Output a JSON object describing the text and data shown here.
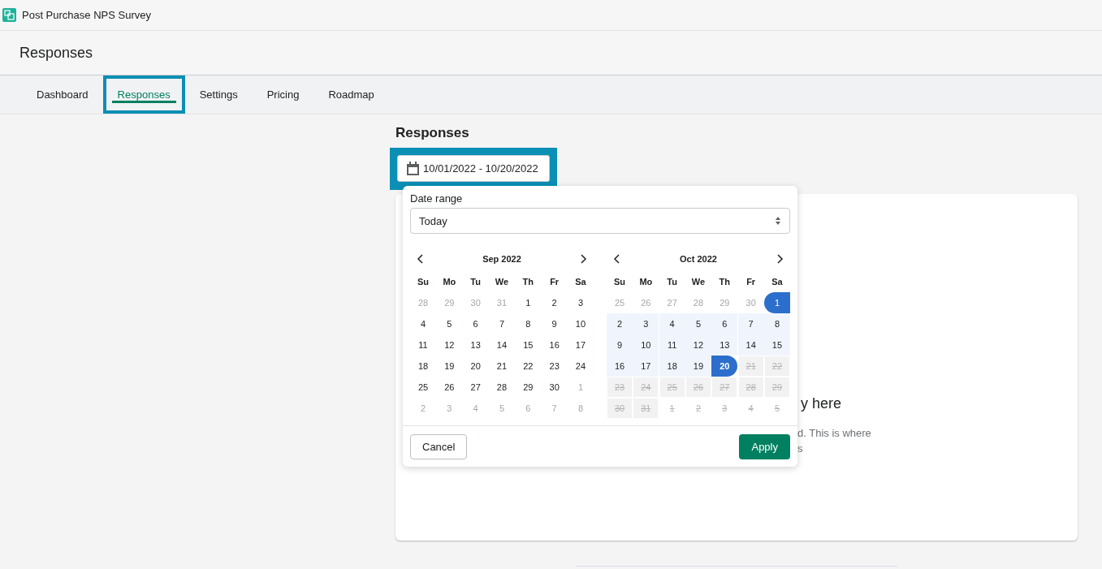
{
  "app_bar": {
    "title": "Post Purchase NPS Survey"
  },
  "page_header": {
    "title": "Responses"
  },
  "tabs": [
    {
      "label": "Dashboard",
      "selected": false,
      "highlighted": false
    },
    {
      "label": "Responses",
      "selected": true,
      "highlighted": true
    },
    {
      "label": "Settings",
      "selected": false,
      "highlighted": false
    },
    {
      "label": "Pricing",
      "selected": false,
      "highlighted": false
    },
    {
      "label": "Roadmap",
      "selected": false,
      "highlighted": false
    }
  ],
  "section_title": "Responses",
  "date_button": {
    "label": "10/01/2022 - 10/20/2022",
    "highlighted": true
  },
  "card_text": {
    "heading": "y here",
    "line_1": "d. This is where",
    "line_2": "s"
  },
  "date_picker": {
    "label": "Date range",
    "select_value": "Today",
    "months": [
      {
        "title": "Sep 2022",
        "weekdays": [
          "Su",
          "Mo",
          "Tu",
          "We",
          "Th",
          "Fr",
          "Sa"
        ],
        "weeks": [
          [
            {
              "day": "28",
              "kind": "outside"
            },
            {
              "day": "29",
              "kind": "outside"
            },
            {
              "day": "30",
              "kind": "outside"
            },
            {
              "day": "31",
              "kind": "outside"
            },
            {
              "day": "1",
              "kind": "normal"
            },
            {
              "day": "2",
              "kind": "normal"
            },
            {
              "day": "3",
              "kind": "normal"
            }
          ],
          [
            {
              "day": "4",
              "kind": "normal"
            },
            {
              "day": "5",
              "kind": "normal"
            },
            {
              "day": "6",
              "kind": "normal"
            },
            {
              "day": "7",
              "kind": "normal"
            },
            {
              "day": "8",
              "kind": "normal"
            },
            {
              "day": "9",
              "kind": "normal"
            },
            {
              "day": "10",
              "kind": "normal"
            }
          ],
          [
            {
              "day": "11",
              "kind": "normal"
            },
            {
              "day": "12",
              "kind": "normal"
            },
            {
              "day": "13",
              "kind": "normal"
            },
            {
              "day": "14",
              "kind": "normal"
            },
            {
              "day": "15",
              "kind": "normal"
            },
            {
              "day": "16",
              "kind": "normal"
            },
            {
              "day": "17",
              "kind": "normal"
            }
          ],
          [
            {
              "day": "18",
              "kind": "normal"
            },
            {
              "day": "19",
              "kind": "normal"
            },
            {
              "day": "20",
              "kind": "normal"
            },
            {
              "day": "21",
              "kind": "normal"
            },
            {
              "day": "22",
              "kind": "normal"
            },
            {
              "day": "23",
              "kind": "normal"
            },
            {
              "day": "24",
              "kind": "normal"
            }
          ],
          [
            {
              "day": "25",
              "kind": "normal"
            },
            {
              "day": "26",
              "kind": "normal"
            },
            {
              "day": "27",
              "kind": "normal"
            },
            {
              "day": "28",
              "kind": "normal"
            },
            {
              "day": "29",
              "kind": "normal"
            },
            {
              "day": "30",
              "kind": "normal"
            },
            {
              "day": "1",
              "kind": "outside"
            }
          ],
          [
            {
              "day": "2",
              "kind": "outside"
            },
            {
              "day": "3",
              "kind": "outside"
            },
            {
              "day": "4",
              "kind": "outside"
            },
            {
              "day": "5",
              "kind": "outside"
            },
            {
              "day": "6",
              "kind": "outside"
            },
            {
              "day": "7",
              "kind": "outside"
            },
            {
              "day": "8",
              "kind": "outside"
            }
          ]
        ]
      },
      {
        "title": "Oct 2022",
        "weekdays": [
          "Su",
          "Mo",
          "Tu",
          "We",
          "Th",
          "Fr",
          "Sa"
        ],
        "weeks": [
          [
            {
              "day": "25",
              "kind": "outside"
            },
            {
              "day": "26",
              "kind": "outside"
            },
            {
              "day": "27",
              "kind": "outside"
            },
            {
              "day": "28",
              "kind": "outside"
            },
            {
              "day": "29",
              "kind": "outside"
            },
            {
              "day": "30",
              "kind": "outside"
            },
            {
              "day": "1",
              "kind": "start"
            }
          ],
          [
            {
              "day": "2",
              "kind": "range"
            },
            {
              "day": "3",
              "kind": "range"
            },
            {
              "day": "4",
              "kind": "range"
            },
            {
              "day": "5",
              "kind": "range"
            },
            {
              "day": "6",
              "kind": "range"
            },
            {
              "day": "7",
              "kind": "range"
            },
            {
              "day": "8",
              "kind": "range"
            }
          ],
          [
            {
              "day": "9",
              "kind": "range"
            },
            {
              "day": "10",
              "kind": "range"
            },
            {
              "day": "11",
              "kind": "range"
            },
            {
              "day": "12",
              "kind": "range"
            },
            {
              "day": "13",
              "kind": "range"
            },
            {
              "day": "14",
              "kind": "range"
            },
            {
              "day": "15",
              "kind": "range"
            }
          ],
          [
            {
              "day": "16",
              "kind": "range"
            },
            {
              "day": "17",
              "kind": "range"
            },
            {
              "day": "18",
              "kind": "range"
            },
            {
              "day": "19",
              "kind": "range"
            },
            {
              "day": "20",
              "kind": "end"
            },
            {
              "day": "21",
              "kind": "disabled"
            },
            {
              "day": "22",
              "kind": "disabled"
            }
          ],
          [
            {
              "day": "23",
              "kind": "disabled"
            },
            {
              "day": "24",
              "kind": "disabled"
            },
            {
              "day": "25",
              "kind": "disabled"
            },
            {
              "day": "26",
              "kind": "disabled"
            },
            {
              "day": "27",
              "kind": "disabled"
            },
            {
              "day": "28",
              "kind": "disabled"
            },
            {
              "day": "29",
              "kind": "disabled"
            }
          ],
          [
            {
              "day": "30",
              "kind": "disabled"
            },
            {
              "day": "31",
              "kind": "disabled"
            },
            {
              "day": "1",
              "kind": "disabled_outside"
            },
            {
              "day": "2",
              "kind": "disabled_outside"
            },
            {
              "day": "3",
              "kind": "disabled_outside"
            },
            {
              "day": "4",
              "kind": "disabled_outside"
            },
            {
              "day": "5",
              "kind": "disabled_outside"
            }
          ]
        ]
      }
    ],
    "cancel_button": "Cancel",
    "apply_button": "Apply"
  }
}
